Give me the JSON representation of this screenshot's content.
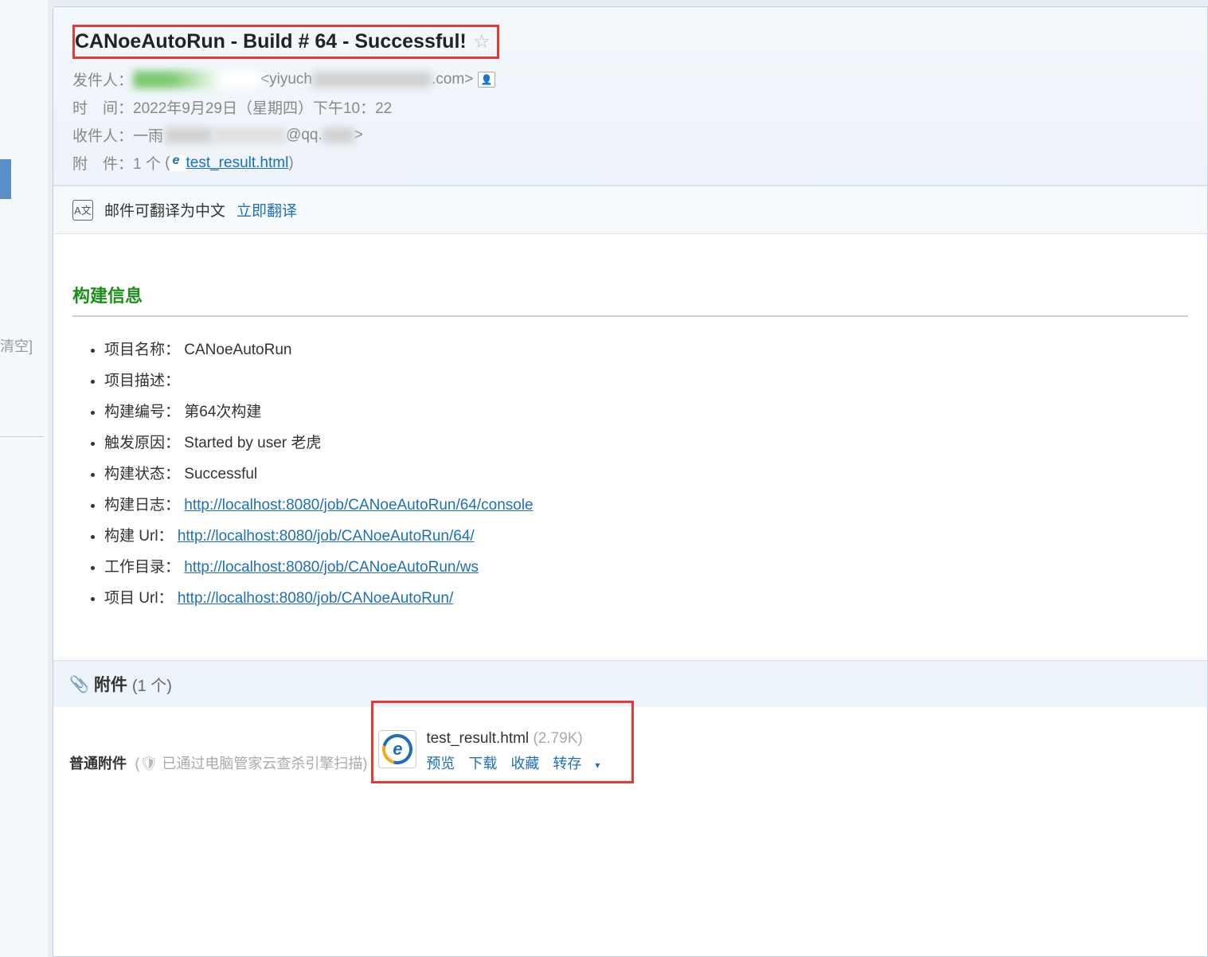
{
  "sidebar": {
    "clear_label": "清空]"
  },
  "email": {
    "subject": "CANoeAutoRun - Build # 64 - Successful!",
    "from_label": "发件人：",
    "from_email_fragment_pre": "<yiyuch",
    "from_email_fragment_post": ".com>",
    "time_label": "时　间：",
    "time_value": "2022年9月29日（星期四）下午10：22",
    "to_label": "收件人：",
    "to_name": "一雨",
    "to_email_fragment": "@qq.",
    "to_email_end": ">",
    "attach_label": "附　件：",
    "attach_count_text": "1 个",
    "attach_file_name": "test_result.html"
  },
  "translate": {
    "notice": "邮件可翻译为中文",
    "action": "立即翻译"
  },
  "build": {
    "section_title": "构建信息",
    "items": [
      {
        "label": "项目名称：",
        "value": "CANoeAutoRun",
        "link": false
      },
      {
        "label": "项目描述：",
        "value": "",
        "link": false
      },
      {
        "label": "构建编号：",
        "value": "第64次构建",
        "link": false
      },
      {
        "label": "触发原因：",
        "value": "Started by user 老虎",
        "link": false
      },
      {
        "label": "构建状态：",
        "value": "Successful",
        "link": false
      },
      {
        "label": "构建日志：",
        "value": "http://localhost:8080/job/CANoeAutoRun/64/console",
        "link": true
      },
      {
        "label": "构建 Url：",
        "value": "http://localhost:8080/job/CANoeAutoRun/64/",
        "link": true
      },
      {
        "label": "工作目录：",
        "value": "http://localhost:8080/job/CANoeAutoRun/ws",
        "link": true
      },
      {
        "label": "项目 Url：",
        "value": "http://localhost:8080/job/CANoeAutoRun/",
        "link": true
      }
    ]
  },
  "attachment": {
    "section_label": "附件",
    "count_text": "(1 个)",
    "normal_label": "普通附件",
    "scan_note": "已通过电脑管家云查杀引擎扫描",
    "file_name": "test_result.html",
    "file_size": "(2.79K)",
    "actions": {
      "preview": "预览",
      "download": "下载",
      "favorite": "收藏",
      "transfer": "转存"
    }
  }
}
